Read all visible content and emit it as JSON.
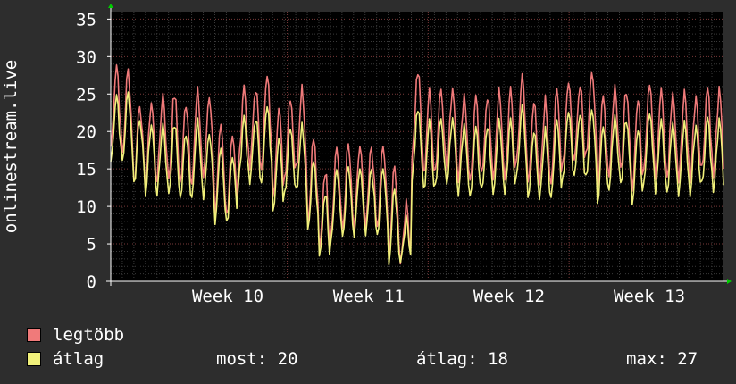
{
  "chart_data": {
    "type": "line",
    "ylabel": "onlinestream.live",
    "ylim": [
      0,
      36
    ],
    "yticks": [
      0,
      5,
      10,
      15,
      20,
      25,
      30,
      35
    ],
    "x_ticks": [
      "Week 10",
      "Week 11",
      "Week 12",
      "Week 13"
    ],
    "grid": true,
    "legend_placement": "bottom-left",
    "colors": {
      "background": "#2d2d2d",
      "plot_bg": "#000000",
      "grid_minor": "#3a3a3a",
      "grid_major": "#7a3a3a",
      "axis": "#ffffff",
      "arrow": "#00cc00",
      "max_series": "#f07a7a",
      "avg_series": "#f0f07a"
    },
    "daily_peaks": {
      "max": [
        29,
        28,
        24,
        24,
        25,
        25,
        24,
        25,
        25,
        20,
        20,
        26,
        26,
        27,
        23,
        25,
        26,
        19,
        15,
        18,
        18,
        18,
        18,
        18,
        15,
        10,
        28,
        25,
        26,
        26,
        25,
        24,
        25,
        25,
        25,
        27,
        24,
        24,
        25,
        27,
        27,
        28,
        24,
        26,
        26,
        24,
        27,
        25,
        25,
        25,
        25,
        26,
        25
      ],
      "avg": [
        25,
        25,
        22,
        21,
        21,
        21,
        20,
        21,
        20,
        17,
        17,
        22,
        22,
        23,
        19,
        21,
        21,
        16,
        12,
        15,
        15,
        15,
        15,
        15,
        12,
        8,
        23,
        21,
        22,
        22,
        21,
        20,
        21,
        21,
        21,
        23,
        20,
        20,
        21,
        23,
        23,
        23,
        20,
        22,
        22,
        20,
        23,
        21,
        21,
        21,
        21,
        22,
        21
      ]
    },
    "series": [
      {
        "name": "legtöbb",
        "color": "#f07a7a"
      },
      {
        "name": "átlag",
        "color": "#f0f07a"
      }
    ]
  },
  "legend": {
    "items": [
      {
        "label": "legtöbb",
        "color": "#f07a7a"
      },
      {
        "label": "átlag",
        "color": "#f0f07a"
      }
    ]
  },
  "stats": {
    "most": "most: 20",
    "avg": "átlag: 18",
    "max": "max: 27"
  }
}
